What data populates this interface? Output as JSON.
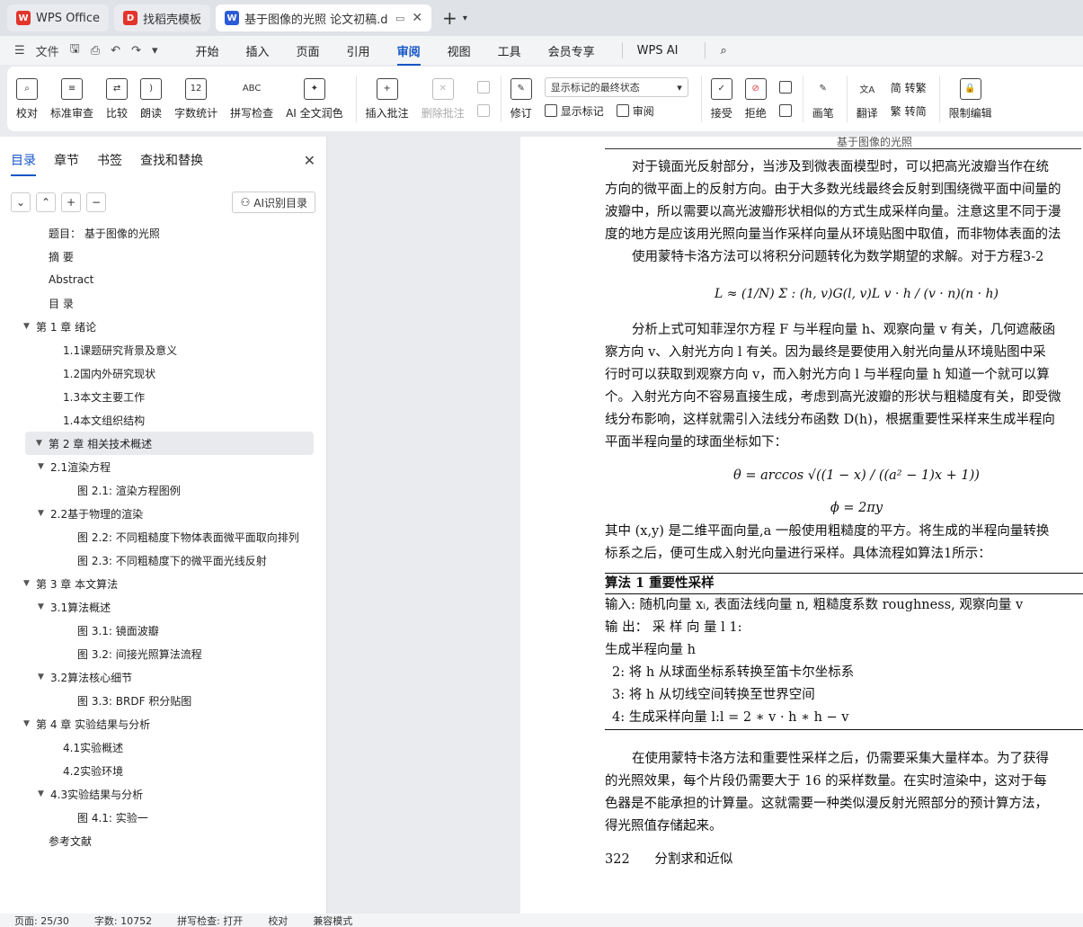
{
  "tabs": [
    {
      "label": "WPS Office",
      "logo": "W",
      "color": "#e2342b"
    },
    {
      "label": "找稻壳模板",
      "logo": "D",
      "color": "#e2342b"
    },
    {
      "label": "基于图像的光照 论文初稿.do",
      "logo": "W",
      "color": "#2b5bd7"
    }
  ],
  "menu": {
    "file_label": "文件",
    "items": [
      "开始",
      "插入",
      "页面",
      "引用",
      "审阅",
      "视图",
      "工具",
      "会员专享",
      "WPS AI"
    ],
    "active": "审阅"
  },
  "ribbon": {
    "proof": "校对",
    "std_review": "标准审查",
    "compare": "比较",
    "read_aloud": "朗读",
    "word_count": "字数统计",
    "spell_check": "拼写检查",
    "ai_polish": "AI 全文润色",
    "insert_comment": "插入批注",
    "delete_comment": "删除批注",
    "track": "修订",
    "markup_select": "显示标记的最终状态",
    "show_markup": "显示标记",
    "review": "审阅",
    "accept": "接受",
    "reject": "拒绝",
    "pen": "画笔",
    "translate": "翻译",
    "to_trad": "简 转繁",
    "to_simp": "繁 转简",
    "restrict": "限制编辑",
    "wordcount_icon_text": "12",
    "spell_icon_text": "ABC"
  },
  "nav": {
    "tabs": [
      "目录",
      "章节",
      "书签",
      "查找和替换"
    ],
    "ai_toc": "AI识别目录",
    "toc": [
      {
        "label": "题目：  基于图像的光照",
        "level": 1,
        "caret": false
      },
      {
        "label": "摘 要",
        "level": 1,
        "caret": false
      },
      {
        "label": "Abstract",
        "level": 1,
        "caret": false
      },
      {
        "label": "目 录",
        "level": 1,
        "caret": false
      },
      {
        "label": "第 1 章  绪论",
        "level": 1,
        "caret": true
      },
      {
        "label": "1.1课题研究背景及意义",
        "level": 2,
        "caret": false
      },
      {
        "label": "1.2国内外研究现状",
        "level": 2,
        "caret": false
      },
      {
        "label": "1.3本文主要工作",
        "level": 2,
        "caret": false
      },
      {
        "label": "1.4本文组织结构",
        "level": 2,
        "caret": false
      },
      {
        "label": "第 2 章  相关技术概述",
        "level": 1,
        "caret": true,
        "highlight": true
      },
      {
        "label": "2.1渲染方程",
        "level": 2,
        "caret": true
      },
      {
        "label": "图 2.1: 渲染方程图例",
        "level": 3,
        "caret": false
      },
      {
        "label": "2.2基于物理的渲染",
        "level": 2,
        "caret": true
      },
      {
        "label": "图 2.2: 不同粗糙度下物体表面微平面取向排列",
        "level": 3,
        "caret": false
      },
      {
        "label": "图 2.3: 不同粗糙度下的微平面光线反射",
        "level": 3,
        "caret": false
      },
      {
        "label": "第 3 章  本文算法",
        "level": 1,
        "caret": true
      },
      {
        "label": "3.1算法概述",
        "level": 2,
        "caret": true
      },
      {
        "label": "图 3.1: 镜面波瓣",
        "level": 3,
        "caret": false
      },
      {
        "label": "图 3.2: 间接光照算法流程",
        "level": 3,
        "caret": false
      },
      {
        "label": "3.2算法核心细节",
        "level": 2,
        "caret": true
      },
      {
        "label": "图 3.3: BRDF 积分贴图",
        "level": 3,
        "caret": false
      },
      {
        "label": "第 4 章  实验结果与分析",
        "level": 1,
        "caret": true
      },
      {
        "label": "4.1实验概述",
        "level": 2,
        "caret": false
      },
      {
        "label": "4.2实验环境",
        "level": 2,
        "caret": false
      },
      {
        "label": "4.3实验结果与分析",
        "level": 2,
        "caret": true
      },
      {
        "label": "图 4.1: 实验一",
        "level": 3,
        "caret": false
      },
      {
        "label": "参考文献",
        "level": 1,
        "caret": false
      }
    ]
  },
  "doc": {
    "header": "基于图像的光照",
    "p1": [
      "对于镜面光反射部分，当涉及到微表面模型时，可以把高光波瓣当作在统",
      "方向的微平面上的反射方向。由于大多数光线最终会反射到围绕微平面中间量的",
      "波瓣中，所以需要以高光波瓣形状相似的方式生成采样向量。注意这里不同于漫",
      "度的地方是应该用光照向量当作采样向量从环境贴图中取值，而非物体表面的法"
    ],
    "p2": "使用蒙特卡洛方法可以将积分问题转化为数学期望的求解。对于方程3-2",
    "eq1": "L ≈ (1/N) Σ : (h, v)G(l, v)L v · h / (v · n)(n · h)",
    "p3": [
      "分析上式可知菲涅尔方程 F 与半程向量 h、观察向量 v 有关，几何遮蔽函",
      "察方向 v、入射光方向 l 有关。因为最终是要使用入射光向量从环境贴图中采",
      "行时可以获取到观察方向 v，而入射光方向 l 与半程向量 h 知道一个就可以算",
      "个。入射光方向不容易直接生成，考虑到高光波瓣的形状与粗糙度有关，即受微",
      "线分布影响，这样就需引入法线分布函数 D(h)，根据重要性采样来生成半程向",
      "平面半程向量的球面坐标如下："
    ],
    "eq2": "θ = arccos √((1 − x) / ((a² − 1)x + 1))",
    "eq3": "ϕ = 2πy",
    "p4": [
      "其中 (x,y) 是二维平面向量,a 一般使用粗糙度的平方。将生成的半程向量转换",
      "标系之后，便可生成入射光向量进行采样。具体流程如算法1所示："
    ],
    "algo_title": "算法 1 重要性采样",
    "algo_input": "输入: 随机向量 xᵢ, 表面法线向量 n, 粗糙度系数 roughness, 观察向量 v",
    "algo_output": "输 出：                         采 样 向 量                        l 1:",
    "algo_steps": [
      "生成半程向量 h",
      "2: 将 h 从球面坐标系转换至笛卡尔坐标系",
      "3: 将 h 从切线空间转换至世界空间",
      "4: 生成采样向量 l:l = 2 ∗ v · h ∗ h − v"
    ],
    "p5": [
      "在使用蒙特卡洛方法和重要性采样之后，仍需要采集大量样本。为了获得",
      "的光照效果，每个片段仍需要大于 16 的采样数量。在实时渲染中，这对于每",
      "色器是不能承担的计算量。这就需要一种类似漫反射光照部分的预计算方法，",
      "得光照值存储起来。"
    ],
    "section": "322      分割求和近似"
  },
  "status": {
    "page": "页面: 25/30",
    "words": "字数: 10752",
    "spell": "拼写检查: 打开",
    "proof": "校对",
    "compat": "兼容模式"
  }
}
